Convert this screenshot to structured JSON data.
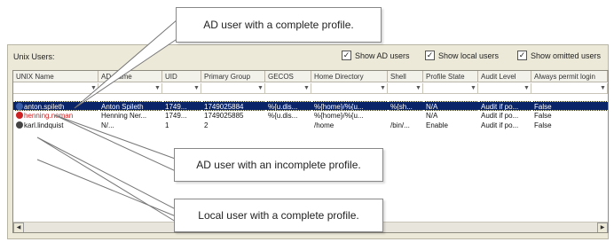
{
  "panel": {
    "title": "Unix Users:",
    "checkboxes": [
      {
        "label": "Show AD users",
        "checked": true
      },
      {
        "label": "Show local users",
        "checked": true
      },
      {
        "label": "Show omitted users",
        "checked": true
      }
    ]
  },
  "grid": {
    "columns": [
      "UNIX Name",
      "AD Name",
      "UID",
      "Primary Group",
      "GECOS",
      "Home Directory",
      "Shell",
      "Profile State",
      "Audit Level",
      "Always permit login"
    ],
    "rows": [
      {
        "unix_name": "anton.spileth",
        "ad_name": "Anton Spileth",
        "uid": "1749...",
        "group": "1749025884",
        "gecos": "%{u.dis...",
        "home": "%{home}/%{u...",
        "shell": "%{sh...",
        "state": "N/A",
        "audit": "Audit if po...",
        "permit": "False",
        "selected": true,
        "icon_color": "#3a5fa8",
        "name_color": "#ffffff"
      },
      {
        "unix_name": "henning.neman",
        "ad_name": "Henning Ner...",
        "uid": "1749...",
        "group": "1749025885",
        "gecos": "%{u.dis...",
        "home": "%{home}/%{u...",
        "shell": "",
        "state": "N/A",
        "audit": "Audit if po...",
        "permit": "False",
        "selected": false,
        "icon_color": "#cc2222",
        "name_color": "#cc2222"
      },
      {
        "unix_name": "karl.lindquist",
        "ad_name": "N/...",
        "uid": "1",
        "group": "2",
        "gecos": "",
        "home": "/home",
        "shell": "/bin/...",
        "state": "Enable",
        "audit": "Audit if po...",
        "permit": "False",
        "selected": false,
        "icon_color": "#444444",
        "name_color": "#111111"
      }
    ]
  },
  "callouts": {
    "complete": "AD user with a complete profile.",
    "incomplete": "AD user with an incomplete profile.",
    "local": "Local user with a complete profile."
  }
}
